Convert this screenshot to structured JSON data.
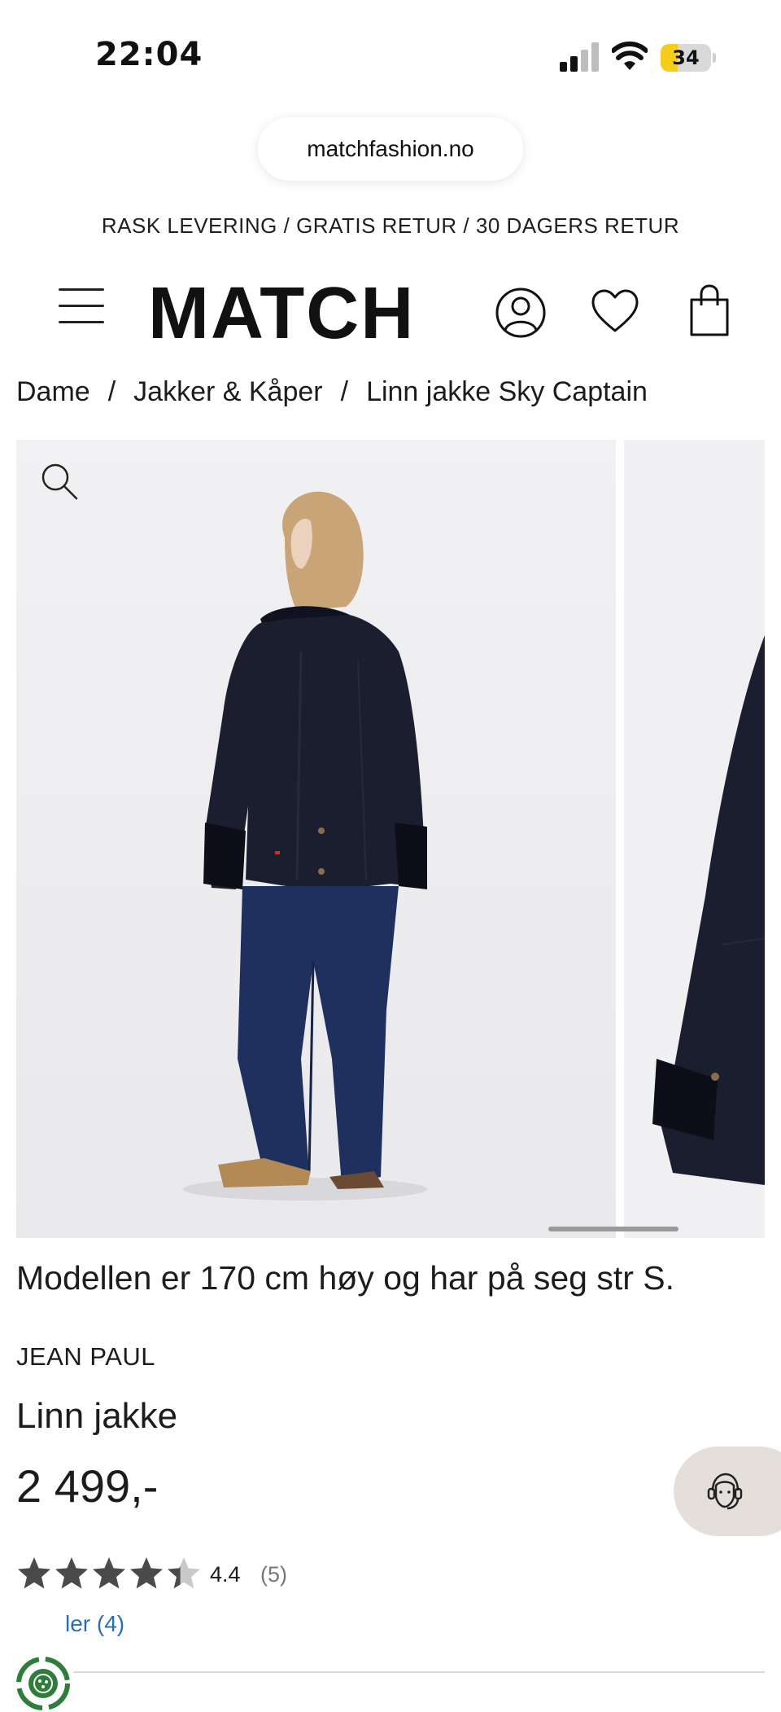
{
  "status_bar": {
    "time": "22:04",
    "battery": "34",
    "battery_level": 0.34
  },
  "browser": {
    "url": "matchfashion.no"
  },
  "promo": {
    "text": "RASK LEVERING / GRATIS RETUR / 30 DAGERS RETUR"
  },
  "header": {
    "logo": "MATCH",
    "icons": [
      "menu-icon",
      "account-icon",
      "heart-icon",
      "shopping-bag-icon"
    ]
  },
  "breadcrumb": {
    "items": [
      "Dame",
      "Jakker & Kåper",
      "Linn jakke Sky Captain"
    ],
    "separator": "/"
  },
  "product": {
    "model_info": "Modellen er 170 cm høy og har på seg str S.",
    "brand": "JEAN PAUL",
    "name": "Linn jakke",
    "price": "2 499,-",
    "rating": {
      "value": "4.4",
      "stars": 4.4,
      "count": "(5)"
    },
    "reviews_link": "ler (4)"
  },
  "colors": {
    "accent_link": "#2a6db5",
    "jacket": "#1b1e2e",
    "jeans": "#1f2f5e",
    "chat_bg": "#e4dfda",
    "eco_green": "#2e7d3b"
  }
}
